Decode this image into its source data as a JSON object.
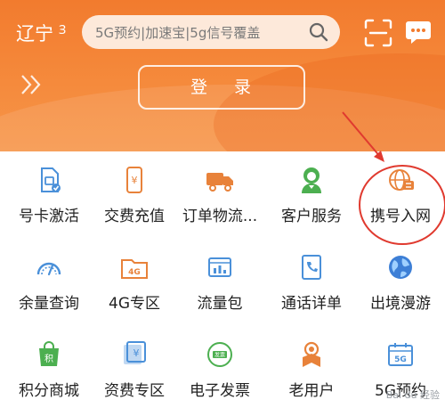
{
  "header": {
    "region": "辽宁",
    "search_placeholder": "5G预约|加速宝|5g信号覆盖",
    "login_label": "登录"
  },
  "services": [
    {
      "label": "号卡激活",
      "icon": "sim-activate-icon"
    },
    {
      "label": "交费充值",
      "icon": "payment-icon"
    },
    {
      "label": "订单物流...",
      "icon": "delivery-truck-icon"
    },
    {
      "label": "客户服务",
      "icon": "customer-service-icon"
    },
    {
      "label": "携号入网",
      "icon": "number-transfer-icon"
    },
    {
      "label": "余量查询",
      "icon": "balance-gauge-icon"
    },
    {
      "label": "4G专区",
      "icon": "4g-folder-icon"
    },
    {
      "label": "流量包",
      "icon": "data-package-icon"
    },
    {
      "label": "通话详单",
      "icon": "call-detail-icon"
    },
    {
      "label": "出境漫游",
      "icon": "globe-icon"
    },
    {
      "label": "积分商城",
      "icon": "points-bag-icon"
    },
    {
      "label": "资费专区",
      "icon": "tariff-icon"
    },
    {
      "label": "电子发票",
      "icon": "invoice-icon"
    },
    {
      "label": "老用户",
      "icon": "old-user-medal-icon"
    },
    {
      "label": "5G预约",
      "icon": "5g-calendar-icon"
    }
  ],
  "colors": {
    "brand_orange": "#f27b2e",
    "icon_blue": "#4a90d9",
    "icon_orange": "#e8823a",
    "icon_green": "#4caf50",
    "annotation_red": "#e03a2f"
  },
  "watermark": "Bai du 经验"
}
